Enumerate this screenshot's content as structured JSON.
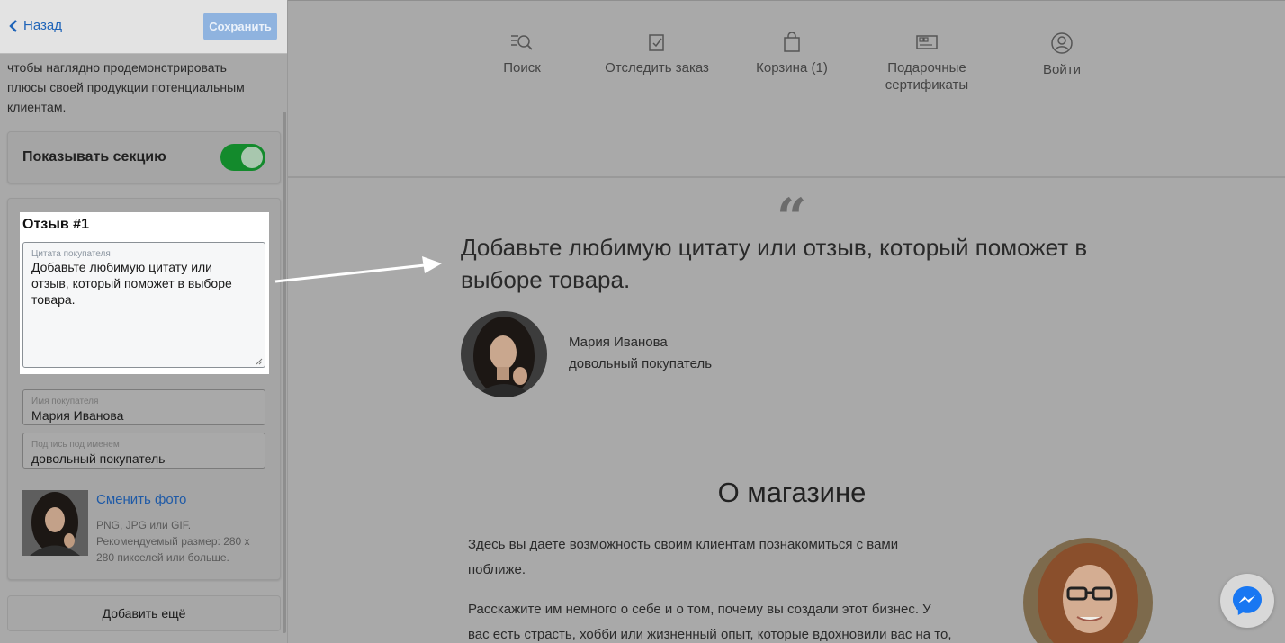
{
  "header": {
    "back_label": "Назад",
    "save_label": "Сохранить"
  },
  "panel": {
    "description_lines": [
      "чтобы наглядно продемонстрировать",
      "плюсы своей продукции потенциальным",
      "клиентам."
    ],
    "show_section_label": "Показывать секцию",
    "show_section_on": true,
    "review": {
      "title": "Отзыв #1",
      "quote_label": "Цитата покупателя",
      "quote_value_lines": [
        "Добавьте любимую цитату или",
        "отзыв, который поможет в выборе",
        "товара."
      ],
      "name_label": "Имя покупателя",
      "name_value": "Мария Иванова",
      "sub_label": "Подпись под именем",
      "sub_value": "довольный покупатель",
      "change_photo": "Сменить фото",
      "photo_hint_lines": [
        "PNG, JPG или GIF.",
        "Рекомендуемый размер: 280 x",
        "280 пикселей или больше."
      ]
    },
    "add_more_label": "Добавить ещё"
  },
  "nav": {
    "items": [
      {
        "icon": "search-icon",
        "label_lines": [
          "Поиск"
        ]
      },
      {
        "icon": "track-order-icon",
        "label_lines": [
          "Отследить заказ"
        ]
      },
      {
        "icon": "cart-icon",
        "label_lines": [
          "Корзина (1)"
        ]
      },
      {
        "icon": "gift-card-icon",
        "label_lines": [
          "Подарочные",
          "сертификаты"
        ]
      },
      {
        "icon": "user-icon",
        "label_lines": [
          "Войти"
        ]
      }
    ]
  },
  "testimonial": {
    "quote_mark": "“",
    "quote_lines": [
      "Добавьте любимую цитату или отзыв, который поможет в",
      "выборе товара."
    ],
    "author_name": "Мария Иванова",
    "author_sub": "довольный покупатель"
  },
  "about": {
    "title": "О магазине",
    "p1_lines": [
      "Здесь вы даете возможность своим клиентам познакомиться с вами",
      "поближе."
    ],
    "p2_lines": [
      "Расскажите им немного о себе и о том, почему вы создали этот бизнес. У",
      "вас есть страсть, хобби или жизненный опыт, которые вдохновили вас на то,"
    ]
  },
  "colors": {
    "accent_link": "#1f64b8",
    "toggle_on": "#138a2c",
    "messenger": "#1877f2"
  }
}
